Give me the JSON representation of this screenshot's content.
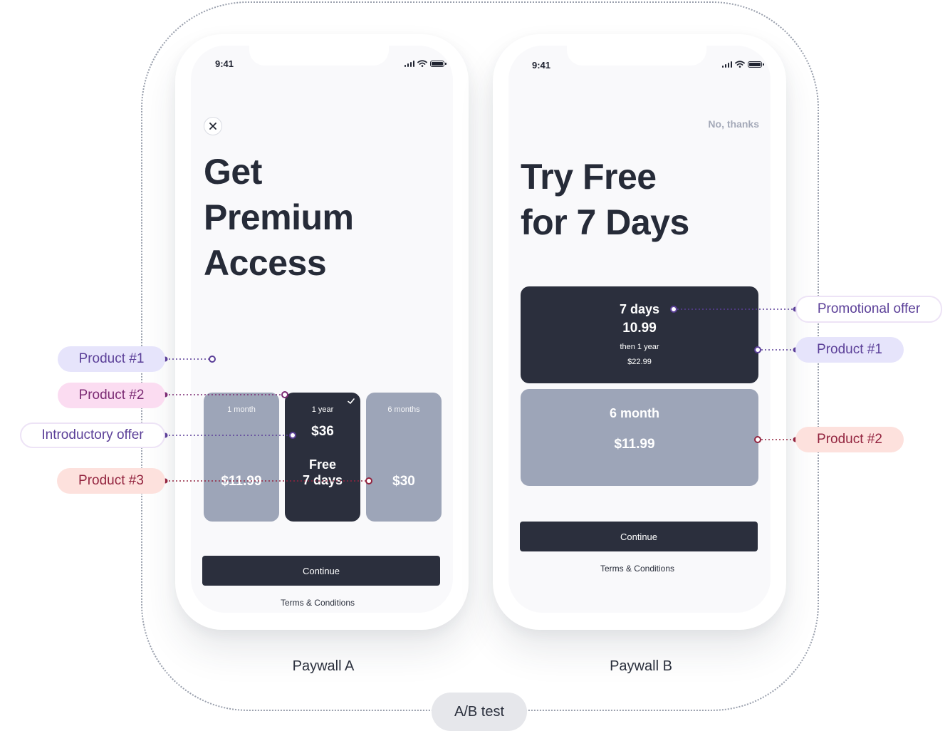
{
  "ab_test_label": "A/B test",
  "paywall_a": {
    "caption": "Paywall A",
    "time": "9:41",
    "headline": "Get\nPremium\nAccess",
    "products": [
      {
        "period": "1 month",
        "price": "$11.99",
        "selected": false
      },
      {
        "period": "1 year",
        "price": "$36",
        "offer": "Free\n7 days",
        "selected": true
      },
      {
        "period": "6 months",
        "price": "$30",
        "selected": false
      }
    ],
    "continue_label": "Continue",
    "terms_label": "Terms & Conditions"
  },
  "paywall_b": {
    "caption": "Paywall B",
    "time": "9:41",
    "dismiss_label": "No, thanks",
    "headline": "Try Free\nfor 7 Days",
    "products": [
      {
        "offer": "7 days",
        "offer_price": "10.99",
        "then_label": "then 1 year",
        "price": "$22.99",
        "selected": true
      },
      {
        "period": "6 month",
        "price": "$11.99",
        "selected": false
      }
    ],
    "continue_label": "Continue",
    "terms_label": "Terms & Conditions"
  },
  "annotations": {
    "left": [
      "Product #1",
      "Product #2",
      "Introductory offer",
      "Product #3"
    ],
    "right": [
      "Promotional offer",
      "Product #1",
      "Product #2"
    ]
  },
  "colors": {
    "dark_card": "#2b2f3d",
    "gray_card": "#9da5b8",
    "purple_line": "#5b3f98",
    "pink_line": "#7b2a73",
    "salmon_line": "#93243f"
  }
}
